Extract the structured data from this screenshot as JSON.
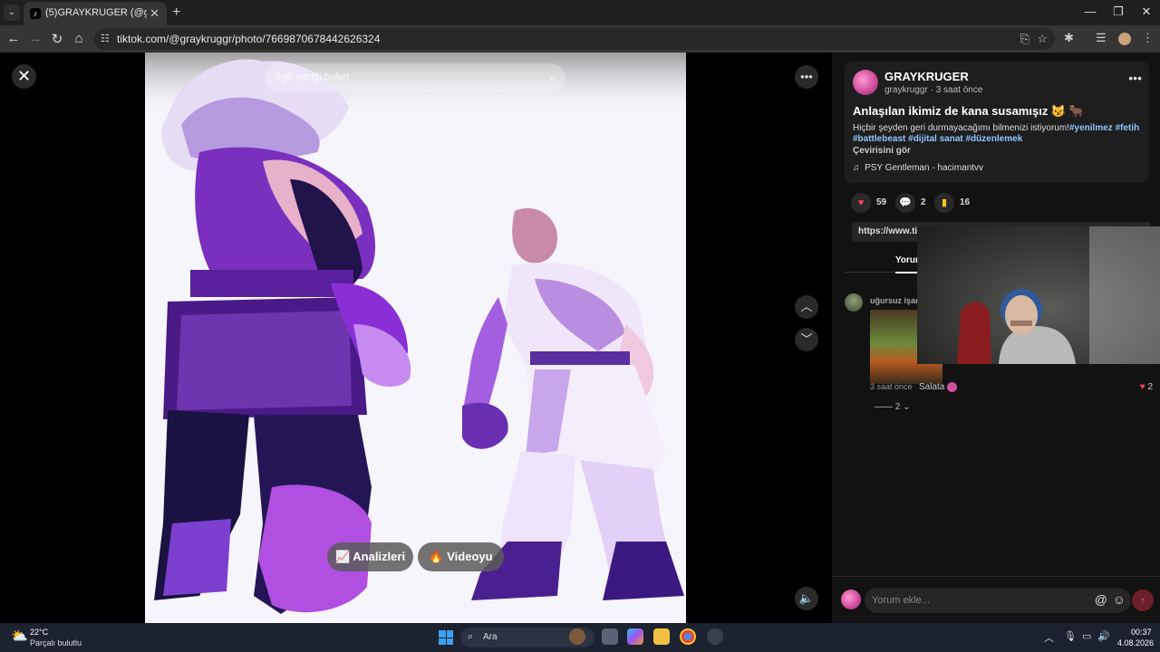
{
  "browser": {
    "tab_title": "(5)GRAYKRUGER (@grayk...",
    "url": "tiktok.com/@graykruggr/photo/7669870678442626324"
  },
  "viewer": {
    "search_placeholder": "İlgili içeriği bulun",
    "analytics_label": "Analizleri",
    "video_label": "Videoyu"
  },
  "post": {
    "author_name": "GRAYKRUGER",
    "author_handle": "graykruggr",
    "time_ago": "3 saat önce",
    "title": "Anlaşılan ikimiz de kana susamışız 😼 🐂",
    "description": "Hiçbir şeyden geri durmayacağımı bilmenizi istiyorum!",
    "hashtags": [
      "#yenilmez",
      "#fetih",
      "#battlebeast",
      "#dijital sanat",
      "#düzenlemek"
    ],
    "see_translation": "Çevirisini gör",
    "music": "PSY Gentleman - hacimantvv",
    "likes": "59",
    "comments": "2",
    "saves": "16",
    "link": "https://www.tik"
  },
  "comments_tab": "Yorum",
  "comment": {
    "user": "uğursuz işar",
    "time": "3 saat önce",
    "reply_label": "Salata",
    "likes": "2",
    "replies_count": "2"
  },
  "comment_input_placeholder": "Yorum ekle...",
  "taskbar": {
    "weather_temp": "22°C",
    "weather_desc": "Parçalı bulutlu",
    "search_label": "Ara",
    "time": "00:37",
    "date": "4.08.2026"
  },
  "colors": {
    "panel_bg": "#121212",
    "hashtag": "#8fc7ff",
    "like_red": "#ff3b5c",
    "save_yellow": "#f5c518"
  }
}
